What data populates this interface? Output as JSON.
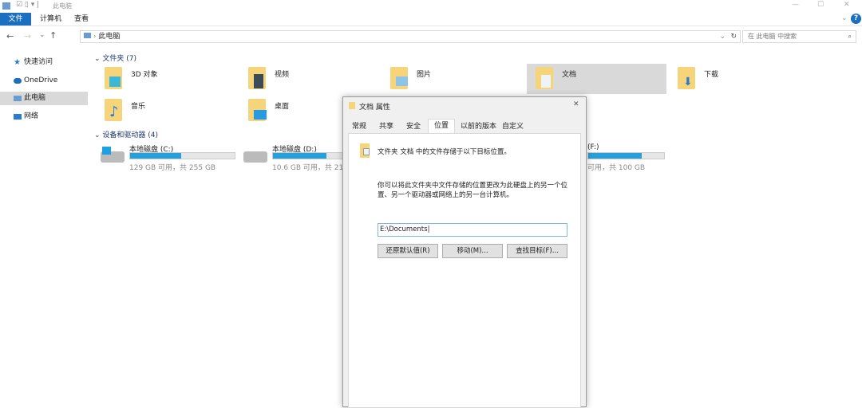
{
  "titlebar": {
    "title": "此电脑",
    "minimize": "—",
    "maximize": "☐",
    "close": "✕"
  },
  "ribbon": {
    "tabs": [
      "文件",
      "计算机",
      "查看"
    ],
    "help": "?"
  },
  "address": {
    "back": "←",
    "forward": "→",
    "recent": "⌄",
    "up": "↑",
    "path": "此电脑",
    "refresh": "↻",
    "search_placeholder": "在 此电脑 中搜索"
  },
  "nav": [
    {
      "label": "快速访问"
    },
    {
      "label": "OneDrive"
    },
    {
      "label": "此电脑"
    },
    {
      "label": "网络"
    }
  ],
  "folders_header": "文件夹 (7)",
  "folders": [
    "3D 对象",
    "视频",
    "图片",
    "文档",
    "下载",
    "音乐",
    "桌面"
  ],
  "drives_header": "设备和驱动器 (4)",
  "drives": [
    {
      "name": "本地磁盘 (C:)",
      "info": "129 GB 可用，共 255 GB",
      "used": 0.49
    },
    {
      "name": "本地磁盘 (D:)",
      "info": "10.6 GB 可用，共 21.8",
      "used": 0.51
    },
    {
      "name": "(F:)",
      "info": "可用，共 100 GB",
      "used": 0.7
    }
  ],
  "dialog": {
    "title": "文档 属性",
    "close": "✕",
    "tabs": [
      "常规",
      "共享",
      "安全",
      "位置",
      "以前的版本",
      "自定义"
    ],
    "heading": "文件夹 文档 中的文件存储于以下目标位置。",
    "description": "你可以将此文件夹中文件存储的位置更改为此硬盘上的另一个位置、另一个驱动器或网络上的另一台计算机。",
    "path": "E:\\Documents",
    "buttons": [
      "还原默认值(R)",
      "移动(M)...",
      "查找目标(F)..."
    ]
  }
}
